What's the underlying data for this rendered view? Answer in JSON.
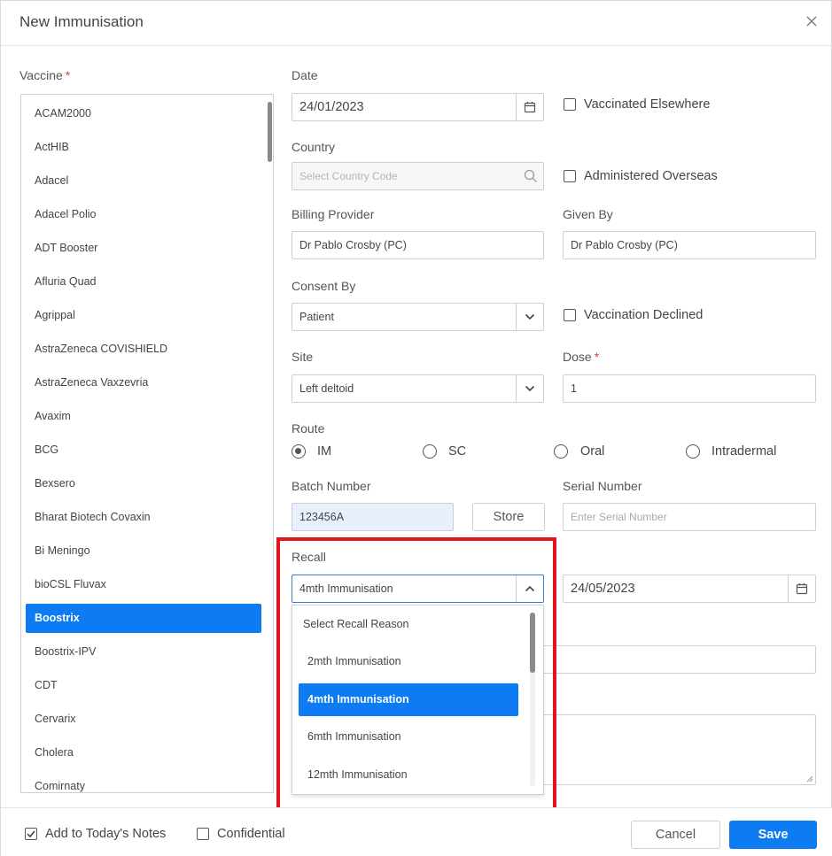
{
  "dialog": {
    "title": "New Immunisation"
  },
  "vaccine": {
    "label": "Vaccine",
    "required_mark": "*",
    "items": [
      "ACAM2000",
      "ActHIB",
      "Adacel",
      "Adacel Polio",
      "ADT Booster",
      "Afluria Quad",
      "Agrippal",
      "AstraZeneca COVISHIELD",
      "AstraZeneca Vaxzevria",
      "Avaxim",
      "BCG",
      "Bexsero",
      "Bharat Biotech Covaxin",
      "Bi Meningo",
      "bioCSL Fluvax",
      "Boostrix",
      "Boostrix-IPV",
      "CDT",
      "Cervarix",
      "Cholera",
      "Comirnaty"
    ],
    "selected": "Boostrix"
  },
  "date": {
    "label": "Date",
    "value": "24/01/2023"
  },
  "vaccinated_elsewhere": {
    "label": "Vaccinated Elsewhere",
    "checked": false
  },
  "country": {
    "label": "Country",
    "placeholder": "Select Country Code"
  },
  "administered_overseas": {
    "label": "Administered Overseas",
    "checked": false
  },
  "billing_provider": {
    "label": "Billing Provider",
    "value": "Dr Pablo Crosby (PC)"
  },
  "given_by": {
    "label": "Given By",
    "value": "Dr Pablo Crosby (PC)"
  },
  "consent_by": {
    "label": "Consent By",
    "value": "Patient"
  },
  "vaccination_declined": {
    "label": "Vaccination Declined",
    "checked": false
  },
  "site": {
    "label": "Site",
    "value": "Left deltoid"
  },
  "dose": {
    "label": "Dose",
    "required_mark": "*",
    "value": "1"
  },
  "route": {
    "label": "Route",
    "options": [
      "IM",
      "SC",
      "Oral",
      "Intradermal"
    ],
    "selected": "IM"
  },
  "batch_number": {
    "label": "Batch Number",
    "value": "123456A",
    "store_label": "Store"
  },
  "serial_number": {
    "label": "Serial Number",
    "placeholder": "Enter Serial Number"
  },
  "recall": {
    "label": "Recall",
    "value": "4mth Immunisation",
    "date": "24/05/2023",
    "options": [
      "Select Recall Reason",
      "2mth Immunisation",
      "4mth Immunisation",
      "6mth Immunisation",
      "12mth Immunisation"
    ],
    "selected": "4mth Immunisation"
  },
  "footer": {
    "add_to_notes_label": "Add to Today's Notes",
    "add_to_notes_checked": true,
    "confidential_label": "Confidential",
    "confidential_checked": false,
    "cancel_label": "Cancel",
    "save_label": "Save"
  },
  "colors": {
    "accent": "#0d7cf2",
    "highlight": "#e8141c",
    "required": "#e53935"
  }
}
